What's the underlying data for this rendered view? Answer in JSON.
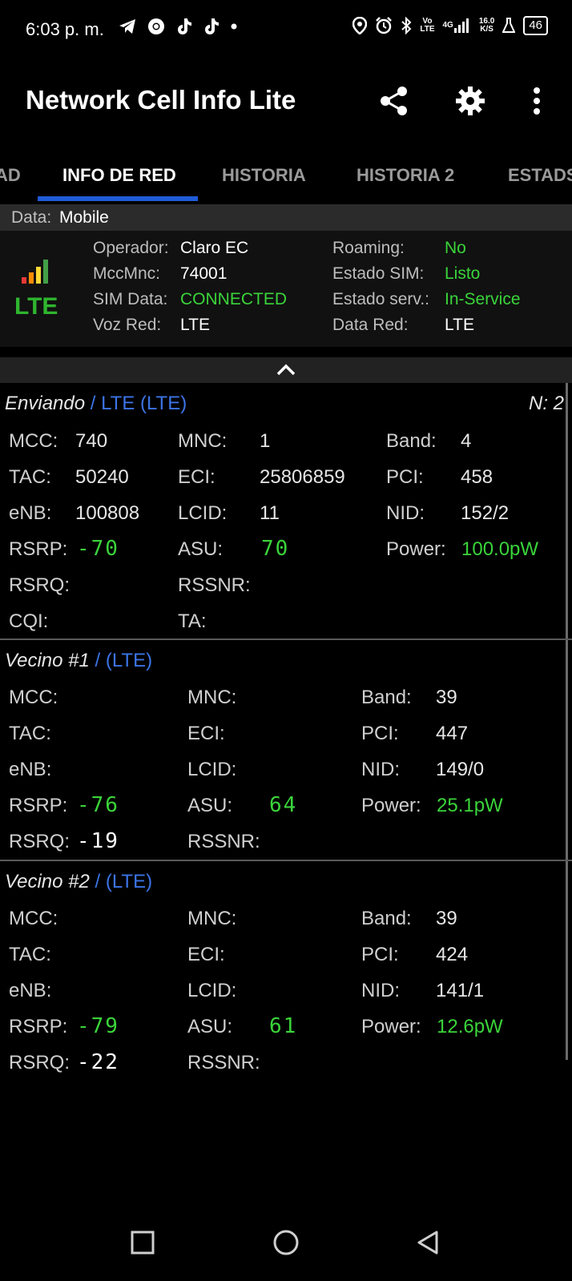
{
  "status_bar": {
    "time": "6:03 p. m.",
    "left_icons": [
      "telegram-icon",
      "chrome-icon",
      "tiktok-icon",
      "tiktok-icon",
      "dot-icon"
    ],
    "right_icons": [
      "location-icon",
      "alarm-icon",
      "bluetooth-icon",
      "volte-icon",
      "4g-signal-icon",
      "data-speed-icon",
      "flask-icon",
      "battery-icon"
    ],
    "volte_top": "Vo",
    "volte_bottom": "LTE",
    "net_top": "4G",
    "speed_top": "16.0",
    "speed_bottom": "K/S",
    "battery": "46"
  },
  "app_bar": {
    "title": "Network Cell Info Lite",
    "actions": [
      "share-icon",
      "settings-icon",
      "more-vert-icon"
    ]
  },
  "tabs": [
    {
      "label": "AD"
    },
    {
      "label": "INFO DE RED"
    },
    {
      "label": "HISTORIA"
    },
    {
      "label": "HISTORIA 2"
    },
    {
      "label": "ESTADS"
    }
  ],
  "data_row": {
    "label": "Data:",
    "value": "Mobile"
  },
  "operator": {
    "network_type": "LTE",
    "signal_colors": [
      "#e53935",
      "#fb8c00",
      "#fdd835",
      "#43a047"
    ],
    "left": [
      {
        "label": "Operador:",
        "value": "Claro EC"
      },
      {
        "label": "MccMnc:",
        "value": "74001"
      },
      {
        "label": "SIM Data:",
        "value": "CONNECTED"
      },
      {
        "label": "Voz Red:",
        "value": "LTE"
      }
    ],
    "right": [
      {
        "label": "Roaming:",
        "value": "No"
      },
      {
        "label": "Estado SIM:",
        "value": "Listo"
      },
      {
        "label": "Estado serv.:",
        "value": "In-Service"
      },
      {
        "label": "Data Red:",
        "value": "LTE"
      }
    ]
  },
  "serving": {
    "title": "Enviando",
    "tech": "/ LTE (LTE)",
    "n": "N: 2",
    "mcc_label": "MCC:",
    "mcc": "740",
    "mnc_label": "MNC:",
    "mnc": "1",
    "band_label": "Band:",
    "band": "4",
    "tac_label": "TAC:",
    "tac": "50240",
    "eci_label": "ECI:",
    "eci": "25806859",
    "pci_label": "PCI:",
    "pci": "458",
    "enb_label": "eNB:",
    "enb": "100808",
    "lcid_label": "LCID:",
    "lcid": "11",
    "nid_label": "NID:",
    "nid": "152/2",
    "rsrp_label": "RSRP:",
    "rsrp": "-70",
    "asu_label": "ASU:",
    "asu": "70",
    "power_label": "Power:",
    "power": "100.0pW",
    "rsrq_label": "RSRQ:",
    "rssnr_label": "RSSNR:",
    "cqi_label": "CQI:",
    "ta_label": "TA:"
  },
  "neighbor1": {
    "title": "Vecino #1",
    "tech": "/ (LTE)",
    "mcc_label": "MCC:",
    "mnc_label": "MNC:",
    "band_label": "Band:",
    "band": "39",
    "tac_label": "TAC:",
    "eci_label": "ECI:",
    "pci_label": "PCI:",
    "pci": "447",
    "enb_label": "eNB:",
    "lcid_label": "LCID:",
    "nid_label": "NID:",
    "nid": "149/0",
    "rsrp_label": "RSRP:",
    "rsrp": "-76",
    "asu_label": "ASU:",
    "asu": "64",
    "power_label": "Power:",
    "power": "25.1pW",
    "rsrq_label": "RSRQ:",
    "rsrq": "-19",
    "rssnr_label": "RSSNR:"
  },
  "neighbor2": {
    "title": "Vecino #2",
    "tech": "/ (LTE)",
    "mcc_label": "MCC:",
    "mnc_label": "MNC:",
    "band_label": "Band:",
    "band": "39",
    "tac_label": "TAC:",
    "eci_label": "ECI:",
    "pci_label": "PCI:",
    "pci": "424",
    "enb_label": "eNB:",
    "lcid_label": "LCID:",
    "nid_label": "NID:",
    "nid": "141/1",
    "rsrp_label": "RSRP:",
    "rsrp": "-79",
    "asu_label": "ASU:",
    "asu": "61",
    "power_label": "Power:",
    "power": "12.6pW",
    "rsrq_label": "RSRQ:",
    "rsrq": "-22",
    "rssnr_label": "RSSNR:"
  },
  "nav_bar": [
    "recents-icon",
    "home-icon",
    "back-icon"
  ]
}
